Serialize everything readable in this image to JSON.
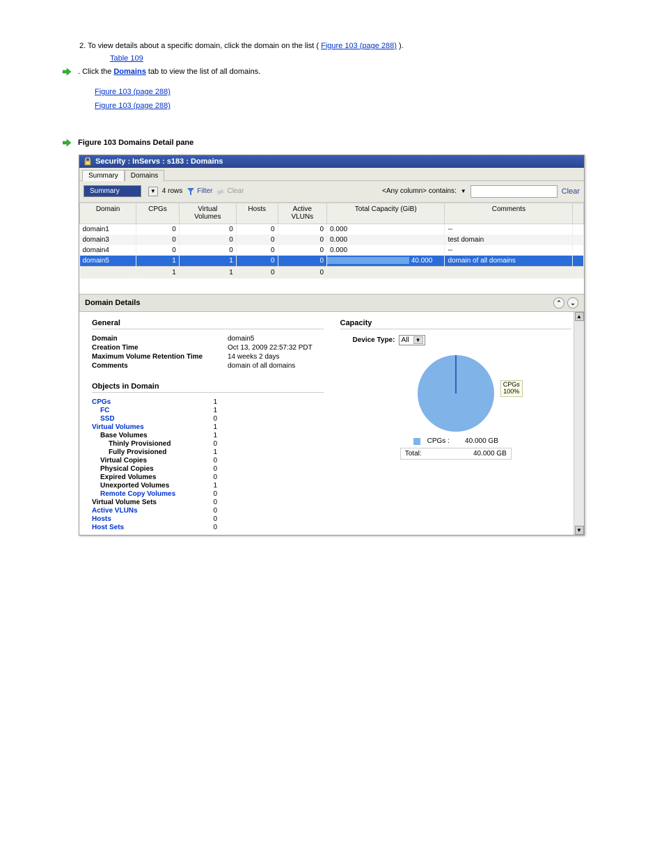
{
  "intro_link": "Table 109",
  "step_sentence": ". Click the ",
  "step_link": "Domains",
  "step_tail": " tab to view the list of all domains.",
  "step2_text": "2. To view details about a specific domain, click the domain on the list (",
  "step2_link": "Figure 103 (page 288)",
  "step2_tail": ").",
  "fig_caption": "Figure 103 Domains Detail pane",
  "titlebar": "Security : InServs : s183 : Domains",
  "tabs": [
    "Summary",
    "Domains"
  ],
  "toolbar": {
    "summary_sel": "Summary",
    "rows": "4 rows",
    "filter": "Filter",
    "clear": "Clear",
    "anycol": "<Any column> contains:",
    "clear2": "Clear"
  },
  "headers": [
    "Domain",
    "CPGs",
    "Virtual Volumes",
    "Hosts",
    "Active VLUNs",
    "Total Capacity (GiB)",
    "Comments"
  ],
  "rows": [
    {
      "d": "domain1",
      "c": "0",
      "v": "0",
      "h": "0",
      "a": "0",
      "t": "0.000",
      "bar": 0,
      "cm": "--",
      "sel": false
    },
    {
      "d": "domain3",
      "c": "0",
      "v": "0",
      "h": "0",
      "a": "0",
      "t": "0.000",
      "bar": 0,
      "cm": "test domain",
      "sel": false
    },
    {
      "d": "domain4",
      "c": "0",
      "v": "0",
      "h": "0",
      "a": "0",
      "t": "0.000",
      "bar": 0,
      "cm": "--",
      "sel": false
    },
    {
      "d": "domain5",
      "c": "1",
      "v": "1",
      "h": "0",
      "a": "0",
      "t": "40.000",
      "bar": 70,
      "cm": "domain of all domains",
      "sel": true
    }
  ],
  "totals": {
    "c": "1",
    "v": "1",
    "h": "0",
    "a": "0"
  },
  "details_title": "Domain Details",
  "general": {
    "title": "General",
    "domain_k": "Domain",
    "domain_v": "domain5",
    "ctime_k": "Creation Time",
    "ctime_v": "Oct 13, 2009 22:57:32 PDT",
    "ret_k": "Maximum Volume Retention Time",
    "ret_v": "14 weeks 2 days",
    "com_k": "Comments",
    "com_v": "domain of all domains"
  },
  "objects": {
    "title": "Objects in Domain",
    "items": [
      {
        "name": "CPGs",
        "val": "1",
        "link": true,
        "ind": 0
      },
      {
        "name": "FC",
        "val": "1",
        "link": true,
        "ind": 1
      },
      {
        "name": "SSD",
        "val": "0",
        "link": true,
        "ind": 1
      },
      {
        "name": "Virtual Volumes",
        "val": "1",
        "link": true,
        "ind": 0
      },
      {
        "name": "Base Volumes",
        "val": "1",
        "link": false,
        "ind": 1,
        "bold": true
      },
      {
        "name": "Thinly Provisioned",
        "val": "0",
        "link": false,
        "ind": 2,
        "bold": true
      },
      {
        "name": "Fully Provisioned",
        "val": "1",
        "link": false,
        "ind": 2,
        "bold": true
      },
      {
        "name": "Virtual Copies",
        "val": "0",
        "link": false,
        "ind": 1,
        "bold": true
      },
      {
        "name": "Physical Copies",
        "val": "0",
        "link": false,
        "ind": 1,
        "bold": true
      },
      {
        "name": "Expired Volumes",
        "val": "0",
        "link": false,
        "ind": 1,
        "bold": true
      },
      {
        "name": "Unexported Volumes",
        "val": "1",
        "link": false,
        "ind": 1,
        "bold": true
      },
      {
        "name": "Remote Copy Volumes",
        "val": "0",
        "link": true,
        "ind": 1
      },
      {
        "name": "Virtual Volume Sets",
        "val": "0",
        "link": false,
        "ind": 0,
        "bold": true
      },
      {
        "name": "Active VLUNs",
        "val": "0",
        "link": true,
        "ind": 0
      },
      {
        "name": "Hosts",
        "val": "0",
        "link": true,
        "ind": 0
      },
      {
        "name": "Host Sets",
        "val": "0",
        "link": true,
        "ind": 0
      }
    ]
  },
  "capacity": {
    "title": "Capacity",
    "device_label": "Device Type:",
    "device_value": "All",
    "pie_label1": "CPGs",
    "pie_label2": "100%",
    "row1_label": "CPGs :",
    "row1_val": "40.000 GB",
    "total_label": "Total:",
    "total_val": "40.000 GB"
  },
  "chart_data": {
    "type": "pie",
    "title": "Capacity",
    "series": [
      {
        "name": "CPGs",
        "values": [
          100
        ]
      }
    ],
    "unit": "percent",
    "legend": [
      {
        "name": "CPGs",
        "value": "40.000 GB"
      }
    ],
    "total": "40.000 GB"
  }
}
